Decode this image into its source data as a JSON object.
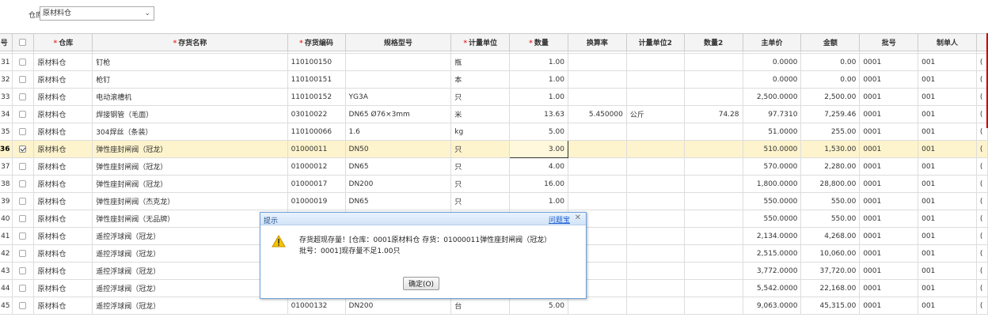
{
  "filter": {
    "warehouse_label": "仓库",
    "warehouse_value": "原材料仓"
  },
  "columns": [
    {
      "label": "序号",
      "req": false
    },
    {
      "label": "",
      "req": false
    },
    {
      "label": "仓库",
      "req": true
    },
    {
      "label": "存货名称",
      "req": true
    },
    {
      "label": "存货编码",
      "req": true
    },
    {
      "label": "规格型号",
      "req": false
    },
    {
      "label": "计量单位",
      "req": true
    },
    {
      "label": "数量",
      "req": true
    },
    {
      "label": "换算率",
      "req": false
    },
    {
      "label": "计量单位2",
      "req": false
    },
    {
      "label": "数量2",
      "req": false
    },
    {
      "label": "主单价",
      "req": false
    },
    {
      "label": "金额",
      "req": false
    },
    {
      "label": "批号",
      "req": false
    },
    {
      "label": "制单人",
      "req": false
    },
    {
      "label": "",
      "req": false
    }
  ],
  "header_visible_labels": [
    "号",
    "",
    "仓库",
    "存货名称",
    "存货编码",
    "规格型号",
    "计量单位",
    "数量",
    "换算率",
    "计量单位2",
    "数量2",
    "主单价",
    "金额",
    "批号",
    "制单人",
    ""
  ],
  "rows": [
    {
      "no": "31",
      "checked": false,
      "wh": "原材料仓",
      "name": "钉枪",
      "code": "110100150",
      "spec": "",
      "unit": "瓶",
      "qty": "1.00",
      "rate": "",
      "unit2": "",
      "qty2": "",
      "price": "0.0000",
      "amount": "0.00",
      "batch": "0001",
      "maker": "001",
      "extra": "("
    },
    {
      "no": "32",
      "checked": false,
      "wh": "原材料仓",
      "name": "枪钉",
      "code": "110100151",
      "spec": "",
      "unit": "本",
      "qty": "1.00",
      "rate": "",
      "unit2": "",
      "qty2": "",
      "price": "0.0000",
      "amount": "0.00",
      "batch": "0001",
      "maker": "001",
      "extra": "("
    },
    {
      "no": "33",
      "checked": false,
      "wh": "原材料仓",
      "name": "电动滚槽机",
      "code": "110100152",
      "spec": "YG3A",
      "unit": "只",
      "qty": "1.00",
      "rate": "",
      "unit2": "",
      "qty2": "",
      "price": "2,500.0000",
      "amount": "2,500.00",
      "batch": "0001",
      "maker": "001",
      "extra": "("
    },
    {
      "no": "34",
      "checked": false,
      "wh": "原材料仓",
      "name": "焊接钢管（毛面）",
      "code": "03010022",
      "spec": "DN65  Ø76×3mm",
      "unit": "米",
      "qty": "13.63",
      "rate": "5.450000",
      "unit2": "公斤",
      "qty2": "74.28",
      "price": "97.7310",
      "amount": "7,259.46",
      "batch": "0001",
      "maker": "001",
      "extra": "("
    },
    {
      "no": "35",
      "checked": false,
      "wh": "原材料仓",
      "name": "304焊丝（条装）",
      "code": "110100066",
      "spec": "1.6",
      "unit": "kg",
      "qty": "5.00",
      "rate": "",
      "unit2": "",
      "qty2": "",
      "price": "51.0000",
      "amount": "255.00",
      "batch": "0001",
      "maker": "001",
      "extra": "("
    },
    {
      "no": "36",
      "checked": true,
      "wh": "原材料仓",
      "name": "弹性座封闸阀（冠龙）",
      "code": "01000011",
      "spec": "DN50",
      "unit": "只",
      "qty": "3.00",
      "rate": "",
      "unit2": "",
      "qty2": "",
      "price": "510.0000",
      "amount": "1,530.00",
      "batch": "0001",
      "maker": "001",
      "extra": "("
    },
    {
      "no": "37",
      "checked": false,
      "wh": "原材料仓",
      "name": "弹性座封闸阀（冠龙）",
      "code": "01000012",
      "spec": "DN65",
      "unit": "只",
      "qty": "4.00",
      "rate": "",
      "unit2": "",
      "qty2": "",
      "price": "570.0000",
      "amount": "2,280.00",
      "batch": "0001",
      "maker": "001",
      "extra": "("
    },
    {
      "no": "38",
      "checked": false,
      "wh": "原材料仓",
      "name": "弹性座封闸阀（冠龙）",
      "code": "01000017",
      "spec": "DN200",
      "unit": "只",
      "qty": "16.00",
      "rate": "",
      "unit2": "",
      "qty2": "",
      "price": "1,800.0000",
      "amount": "28,800.00",
      "batch": "0001",
      "maker": "001",
      "extra": "("
    },
    {
      "no": "39",
      "checked": false,
      "wh": "原材料仓",
      "name": "弹性座封闸阀（杰克龙）",
      "code": "01000019",
      "spec": "DN65",
      "unit": "只",
      "qty": "1.00",
      "rate": "",
      "unit2": "",
      "qty2": "",
      "price": "550.0000",
      "amount": "550.00",
      "batch": "0001",
      "maker": "001",
      "extra": "("
    },
    {
      "no": "40",
      "checked": false,
      "wh": "原材料仓",
      "name": "弹性座封闸阀（无品牌）",
      "code": "",
      "spec": "",
      "unit": "",
      "qty": "",
      "rate": "",
      "unit2": "",
      "qty2": "",
      "price": "550.0000",
      "amount": "550.00",
      "batch": "0001",
      "maker": "001",
      "extra": "("
    },
    {
      "no": "41",
      "checked": false,
      "wh": "原材料仓",
      "name": "遥控浮球阀（冠龙）",
      "code": "",
      "spec": "",
      "unit": "",
      "qty": "",
      "rate": "",
      "unit2": "",
      "qty2": "",
      "price": "2,134.0000",
      "amount": "4,268.00",
      "batch": "0001",
      "maker": "001",
      "extra": "("
    },
    {
      "no": "42",
      "checked": false,
      "wh": "原材料仓",
      "name": "遥控浮球阀（冠龙）",
      "code": "",
      "spec": "",
      "unit": "",
      "qty": "",
      "rate": "",
      "unit2": "",
      "qty2": "",
      "price": "2,515.0000",
      "amount": "10,060.00",
      "batch": "0001",
      "maker": "001",
      "extra": "("
    },
    {
      "no": "43",
      "checked": false,
      "wh": "原材料仓",
      "name": "遥控浮球阀（冠龙）",
      "code": "",
      "spec": "",
      "unit": "",
      "qty": "",
      "rate": "",
      "unit2": "",
      "qty2": "",
      "price": "3,772.0000",
      "amount": "37,720.00",
      "batch": "0001",
      "maker": "001",
      "extra": "("
    },
    {
      "no": "44",
      "checked": false,
      "wh": "原材料仓",
      "name": "遥控浮球阀（冠龙）",
      "code": "",
      "spec": "",
      "unit": "",
      "qty": "",
      "rate": "",
      "unit2": "",
      "qty2": "",
      "price": "5,542.0000",
      "amount": "22,168.00",
      "batch": "0001",
      "maker": "001",
      "extra": "("
    },
    {
      "no": "45",
      "checked": false,
      "wh": "原材料仓",
      "name": "遥控浮球阀（冠龙）",
      "code": "01000132",
      "spec": "DN200",
      "unit": "台",
      "qty": "5.00",
      "rate": "",
      "unit2": "",
      "qty2": "",
      "price": "9,063.0000",
      "amount": "45,315.00",
      "batch": "0001",
      "maker": "001",
      "extra": "("
    }
  ],
  "dialog": {
    "title": "提示",
    "help": "问题宝",
    "close": "✕",
    "message_line1": "存货超现存量！[仓库：0001原材料仓 存货：01000011弹性座封闸阀（冠龙）",
    "message_line2": "批号：0001]现存量不足1.00只",
    "ok_label": "确定(O)"
  },
  "colors": {
    "selected_row": "#fdf3cc",
    "required_mark": "#e33",
    "dialog_border": "#6f9fd8"
  }
}
